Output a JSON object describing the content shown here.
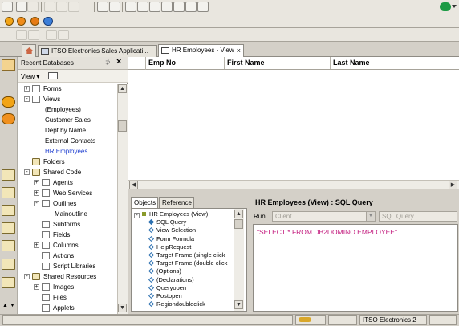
{
  "tabs": [
    {
      "label": "ITSO Electronics Sales Applicati...",
      "active": false
    },
    {
      "label": "HR Employees - View",
      "active": true
    }
  ],
  "left_panel": {
    "title": "Recent Databases",
    "view_menu": "View ▾",
    "tree": [
      {
        "label": "Forms",
        "indent": 1,
        "icon": "form",
        "expander": "+"
      },
      {
        "label": "Views",
        "indent": 1,
        "icon": "view",
        "expander": "-"
      },
      {
        "label": "(Employees)",
        "indent": 2,
        "icon": "none"
      },
      {
        "label": "Customer Sales",
        "indent": 2,
        "icon": "none"
      },
      {
        "label": "Dept by Name",
        "indent": 2,
        "icon": "none"
      },
      {
        "label": "External Contacts",
        "indent": 2,
        "icon": "none"
      },
      {
        "label": "HR Employees",
        "indent": 2,
        "icon": "none",
        "selected": true
      },
      {
        "label": "Folders",
        "indent": 1,
        "icon": "folder"
      },
      {
        "label": "Shared Code",
        "indent": 1,
        "icon": "folder",
        "expander": "-"
      },
      {
        "label": "Agents",
        "indent": 2,
        "icon": "agent",
        "expander": "+"
      },
      {
        "label": "Web Services",
        "indent": 2,
        "icon": "web",
        "expander": "+"
      },
      {
        "label": "Outlines",
        "indent": 2,
        "icon": "outline",
        "expander": "-"
      },
      {
        "label": "Mainoutline",
        "indent": 3,
        "icon": "none"
      },
      {
        "label": "Subforms",
        "indent": 2,
        "icon": "doc"
      },
      {
        "label": "Fields",
        "indent": 2,
        "icon": "field"
      },
      {
        "label": "Columns",
        "indent": 2,
        "icon": "column",
        "expander": "+"
      },
      {
        "label": "Actions",
        "indent": 2,
        "icon": "action"
      },
      {
        "label": "Script Libraries",
        "indent": 2,
        "icon": "script"
      },
      {
        "label": "Shared Resources",
        "indent": 1,
        "icon": "folder",
        "expander": "-"
      },
      {
        "label": "Images",
        "indent": 2,
        "icon": "image",
        "expander": "+"
      },
      {
        "label": "Files",
        "indent": 2,
        "icon": "doc"
      },
      {
        "label": "Applets",
        "indent": 2,
        "icon": "doc"
      }
    ]
  },
  "view_grid": {
    "columns": [
      "Emp No",
      "First Name",
      "Last Name"
    ]
  },
  "objects_panel": {
    "tabs": [
      "Objects",
      "Reference"
    ],
    "items": [
      {
        "label": "HR Employees (View)",
        "indent": 0,
        "expander": "-"
      },
      {
        "label": "SQL Query",
        "indent": 1,
        "marker": "arrow"
      },
      {
        "label": "View Selection",
        "indent": 1
      },
      {
        "label": "Form Formula",
        "indent": 1
      },
      {
        "label": "HelpRequest",
        "indent": 1
      },
      {
        "label": "Target Frame (single click",
        "indent": 1
      },
      {
        "label": "Target Frame (double click",
        "indent": 1
      },
      {
        "label": "(Options)",
        "indent": 1
      },
      {
        "label": "(Declarations)",
        "indent": 1
      },
      {
        "label": "Queryopen",
        "indent": 1
      },
      {
        "label": "Postopen",
        "indent": 1
      },
      {
        "label": "Regiondoubleclick",
        "indent": 1
      }
    ]
  },
  "code_panel": {
    "title": "HR Employees (View) : SQL Query",
    "run_label": "Run",
    "run_value": "Client",
    "lang_value": "SQL Query",
    "code": "\"SELECT * FROM DB2DOMINO.EMPLOYEE\""
  },
  "status_bar": {
    "server": "ITSO Electronics 2"
  },
  "colors": {
    "selected_item": "#1f3fd0",
    "code_text": "#c2187c",
    "lotus_green": "#1c9a44"
  }
}
